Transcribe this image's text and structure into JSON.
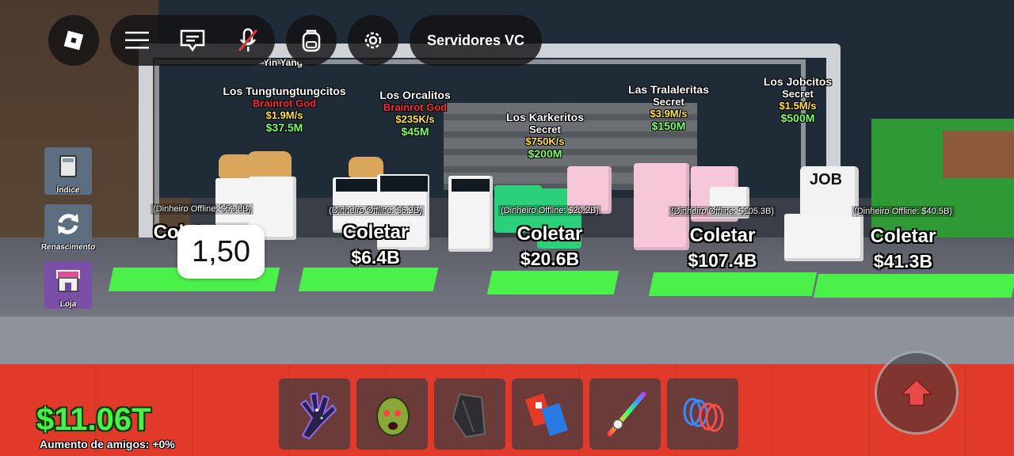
{
  "topbar": {
    "servers_label": "Servidores VC"
  },
  "side_menu": [
    {
      "label": "Índice",
      "icon": "book-icon"
    },
    {
      "label": "Renascimento",
      "icon": "refresh-icon"
    },
    {
      "label": "Loja",
      "icon": "shop-icon"
    }
  ],
  "tooltip": {
    "value": "1,50"
  },
  "top_label": {
    "text": "Yin Yang"
  },
  "pets": [
    {
      "name": "Los Tungtungtungcitos",
      "rarity": "Brainrot God",
      "rate": "$1.9M/s",
      "price": "$37.5M"
    },
    {
      "name": "Los Orcalitos",
      "rarity": "Brainrot God",
      "rate": "$235K/s",
      "price": "$45M"
    },
    {
      "name": "Los Karkeritos",
      "rarity": "Secret",
      "rate": "$750K/s",
      "price": "$200M"
    },
    {
      "name": "Las Tralaleritas",
      "rarity": "Secret",
      "rate": "$3.9M/s",
      "price": "$150M"
    },
    {
      "name": "Los Jobcitos",
      "rarity": "Secret",
      "rate": "$1.5M/s",
      "price": "$500M"
    }
  ],
  "collectors": [
    {
      "offline": "(Dinheiro Offline: $53.8B)",
      "label": "Coletar",
      "value": "$"
    },
    {
      "offline": "(Dinheiro Offline: $6.3B)",
      "label": "Coletar",
      "value": "$6.4B"
    },
    {
      "offline": "(Dinheiro Offline: $20.2B)",
      "label": "Coletar",
      "value": "$20.6B"
    },
    {
      "offline": "(Dinheiro Offline: $105.3B)",
      "label": "Coletar",
      "value": "$107.4B"
    },
    {
      "offline": "(Dinheiro Offline: $40.5B)",
      "label": "Coletar",
      "value": "$41.3B"
    }
  ],
  "hotbar": [
    "galaxy-glove-icon",
    "zombie-head-icon",
    "dark-cape-icon",
    "blaster-icon",
    "rainbow-sword-icon",
    "coil-spring-icon"
  ],
  "status": {
    "money": "$11.06T",
    "friends_boost": "Aumento de amigos: +0%"
  },
  "colors": {
    "money_green": "#4cf04a",
    "rate_yellow": "#ffe14a",
    "price_green": "#7dff6a",
    "red_floor": "#e23a2a"
  }
}
